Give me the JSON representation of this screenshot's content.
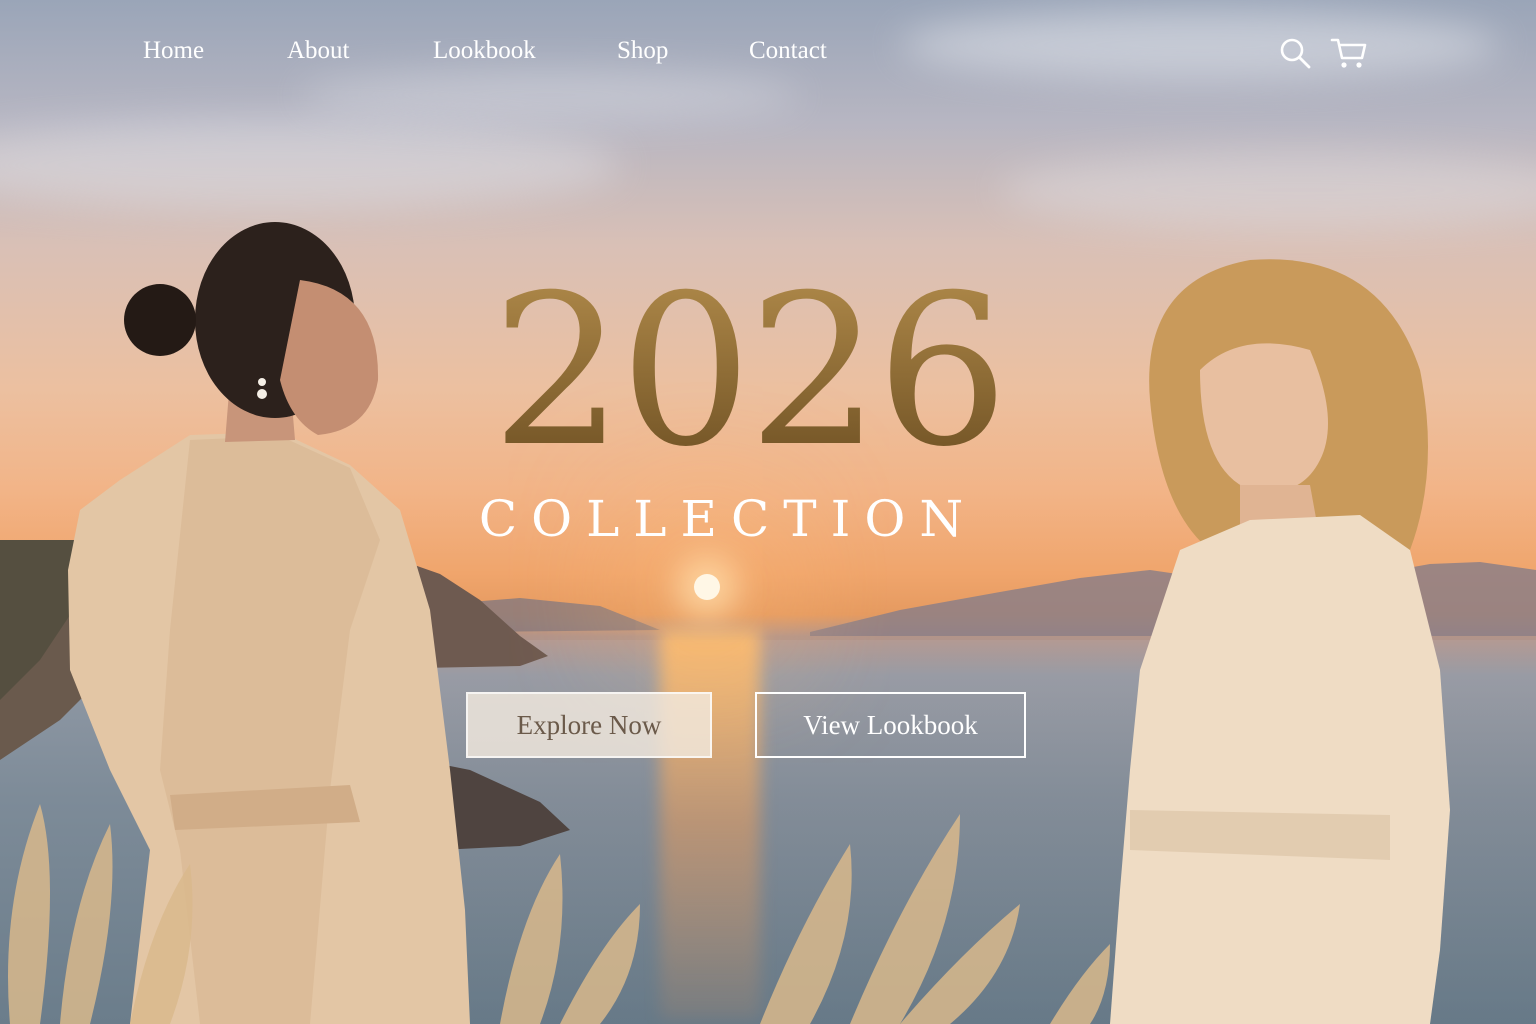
{
  "nav": {
    "items": [
      {
        "label": "Home"
      },
      {
        "label": "About"
      },
      {
        "label": "Lookbook"
      },
      {
        "label": "Shop"
      },
      {
        "label": "Contact"
      }
    ],
    "icons": [
      "search-icon",
      "cart-icon"
    ]
  },
  "hero": {
    "title": "2026",
    "subtitle": "COLLECTION",
    "primary_button": "Explore Now",
    "secondary_button": "View Lookbook"
  },
  "colors": {
    "accent_gold": "#8a6a35",
    "nav_text": "#ffffff",
    "button_fill": "#f2e9de"
  }
}
